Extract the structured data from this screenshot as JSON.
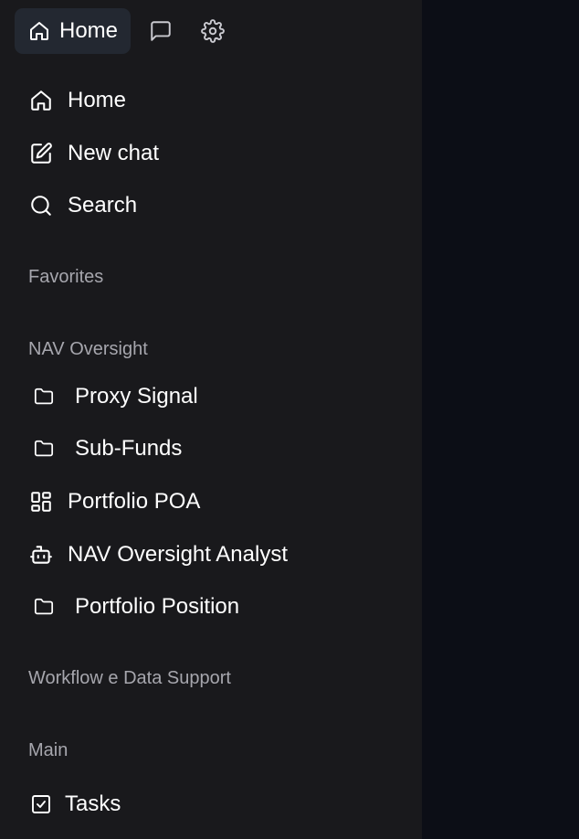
{
  "topbar": {
    "home_label": "Home"
  },
  "nav": {
    "home": "Home",
    "new_chat": "New chat",
    "search": "Search"
  },
  "sections": {
    "favorites": "Favorites",
    "nav_oversight": "NAV Oversight",
    "workflow": "Workflow e Data Support",
    "main": "Main"
  },
  "nav_oversight_items": [
    {
      "label": "Proxy Signal",
      "icon": "folder-icon"
    },
    {
      "label": "Sub-Funds",
      "icon": "folder-icon"
    },
    {
      "label": "Portfolio POA",
      "icon": "layout-dashboard-icon"
    },
    {
      "label": "NAV Oversight Analyst",
      "icon": "bot-icon"
    },
    {
      "label": "Portfolio Position",
      "icon": "folder-icon"
    }
  ],
  "main_items": [
    {
      "label": "Tasks",
      "icon": "checkbox-icon"
    }
  ],
  "colors": {
    "sidebar_bg": "#19191c",
    "pill_bg": "#232831",
    "section_text": "#a6a6ad",
    "main_bg": "#0c0e16"
  }
}
